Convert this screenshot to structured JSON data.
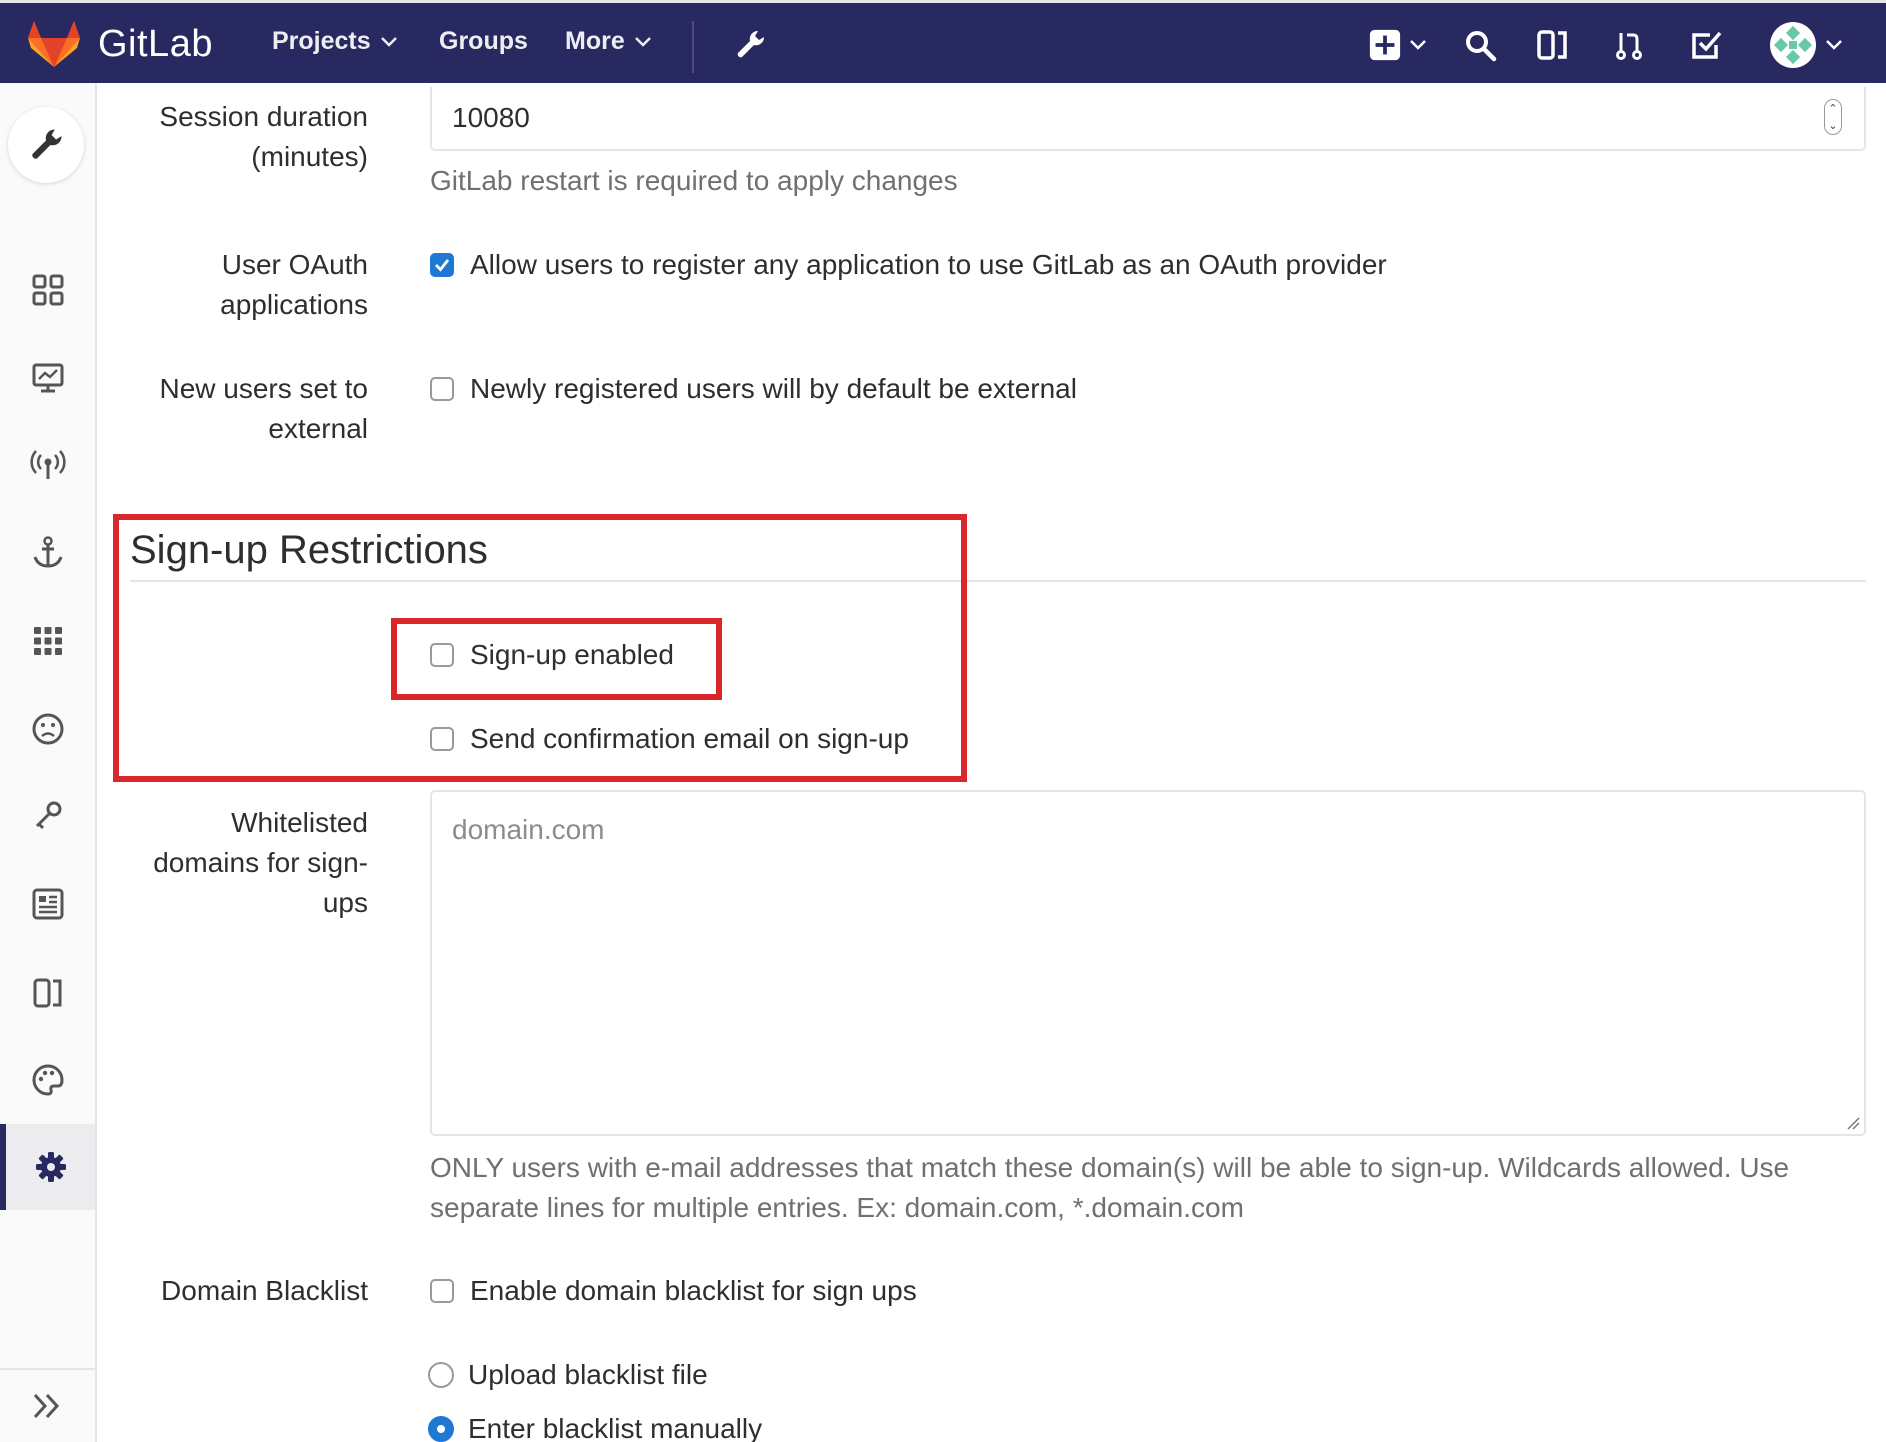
{
  "navbar": {
    "brand": "GitLab",
    "links": [
      {
        "label": "Projects",
        "has_dropdown": true
      },
      {
        "label": "Groups",
        "has_dropdown": false
      },
      {
        "label": "More",
        "has_dropdown": true
      }
    ],
    "icons": [
      "admin-wrench-icon",
      "new-plus-icon",
      "search-icon",
      "issues-icon",
      "merge-requests-icon",
      "todos-icon",
      "user-avatar"
    ],
    "colors": {
      "bar": "#292961",
      "accent": "#fc6d26"
    }
  },
  "sidebar": {
    "top_icon": "admin-wrench-icon",
    "items": [
      "overview-icon",
      "monitoring-icon",
      "messages-icon",
      "system-hooks-icon",
      "applications-icon",
      "abuse-reports-icon",
      "deploy-keys-icon",
      "service-templates-icon",
      "labels-icon",
      "appearance-icon",
      "settings-icon"
    ],
    "active_item": "settings-icon",
    "collapse_icon": "collapse-sidebar-icon"
  },
  "form": {
    "session": {
      "label_line1": "Session duration",
      "label_line2": "(minutes)",
      "value": "10080",
      "help": "GitLab restart is required to apply changes"
    },
    "oauth": {
      "label_line1": "User OAuth",
      "label_line2": "applications",
      "checkbox_label": "Allow users to register any application to use GitLab as an OAuth provider",
      "checked": true
    },
    "external": {
      "label_line1": "New users set to",
      "label_line2": "external",
      "checkbox_label": "Newly registered users will by default be external",
      "checked": false
    },
    "signup_section": {
      "title": "Sign-up Restrictions",
      "signup_enabled": {
        "label": "Sign-up enabled",
        "checked": false
      },
      "send_confirmation": {
        "label": "Send confirmation email on sign-up",
        "checked": false
      }
    },
    "whitelist": {
      "label_line1": "Whitelisted",
      "label_line2": "domains for sign-",
      "label_line3": "ups",
      "placeholder": "domain.com",
      "help_line1": "ONLY users with e-mail addresses that match these domain(s) will be able to sign-up. Wildcards allowed. Use",
      "help_line2": "separate lines for multiple entries. Ex: domain.com, *.domain.com"
    },
    "blacklist": {
      "label": "Domain Blacklist",
      "enable_label": "Enable domain blacklist for sign ups",
      "enable_checked": false,
      "upload_label": "Upload blacklist file",
      "upload_selected": false,
      "manual_label": "Enter blacklist manually",
      "manual_selected": true
    }
  },
  "highlight_color": "#d9262a"
}
